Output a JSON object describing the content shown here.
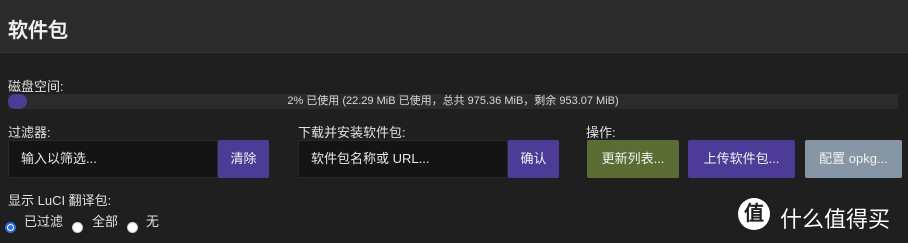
{
  "page": {
    "title": "软件包"
  },
  "disk": {
    "label": "磁盘空间:",
    "used_fraction": 0.02,
    "status_text": "2% 已使用 (22.29 MiB 已使用，总共 975.36 MiB，剩余 953.07 MiB)",
    "bar_color": "#4d3c96"
  },
  "filter": {
    "label": "过滤器:",
    "input_value": "输入以筛选...",
    "clear_label": "清除"
  },
  "download": {
    "label": "下载并安装软件包:",
    "input_value": "软件包名称或 URL...",
    "confirm_label": "确认"
  },
  "actions": {
    "label": "操作:",
    "update_label": "更新列表...",
    "upload_label": "上传软件包...",
    "config_label": "配置 opkg..."
  },
  "translations": {
    "label": "显示 LuCI 翻译包:",
    "options": [
      {
        "label": "已过滤",
        "checked": true
      },
      {
        "label": "全部",
        "checked": false
      },
      {
        "label": "无",
        "checked": false
      }
    ]
  },
  "watermark": {
    "icon_char": "值",
    "text": "什么值得买"
  },
  "colors": {
    "accent_purple": "#4c3b97",
    "green": "#5b6d34",
    "gray": "#8796a5"
  }
}
